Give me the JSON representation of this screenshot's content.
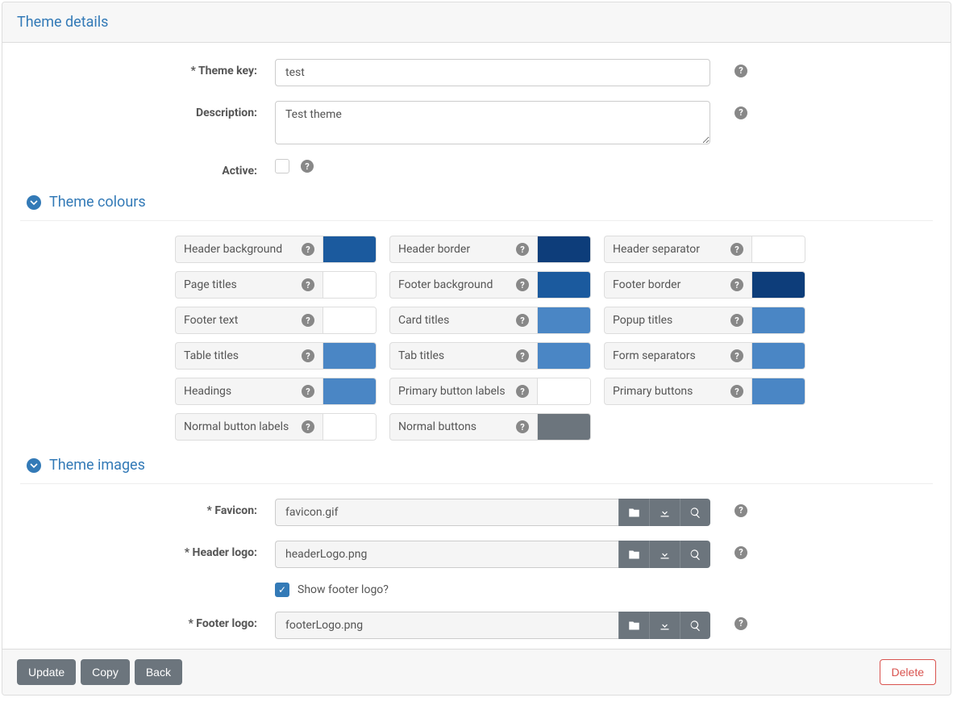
{
  "header": {
    "title": "Theme details"
  },
  "details": {
    "theme_key_label": "* Theme key:",
    "theme_key": "test",
    "description_label": "Description:",
    "description": "Test theme",
    "active_label": "Active:",
    "active": false
  },
  "sections": {
    "colours": {
      "title": "Theme colours"
    },
    "images": {
      "title": "Theme images"
    }
  },
  "colours": [
    {
      "label": "Header background",
      "value": "#1b5a9e"
    },
    {
      "label": "Header border",
      "value": "#0d3d7a"
    },
    {
      "label": "Header separator",
      "value": "#ffffff"
    },
    {
      "label": "Page titles",
      "value": "#ffffff"
    },
    {
      "label": "Footer background",
      "value": "#1b5a9e"
    },
    {
      "label": "Footer border",
      "value": "#0d3d7a"
    },
    {
      "label": "Footer text",
      "value": "#ffffff"
    },
    {
      "label": "Card titles",
      "value": "#4a86c5"
    },
    {
      "label": "Popup titles",
      "value": "#4a86c5"
    },
    {
      "label": "Table titles",
      "value": "#4a86c5"
    },
    {
      "label": "Tab titles",
      "value": "#4a86c5"
    },
    {
      "label": "Form separators",
      "value": "#4a86c5"
    },
    {
      "label": "Headings",
      "value": "#4a86c5"
    },
    {
      "label": "Primary button labels",
      "value": "#ffffff"
    },
    {
      "label": "Primary buttons",
      "value": "#4a86c5"
    },
    {
      "label": "Normal button labels",
      "value": "#ffffff"
    },
    {
      "label": "Normal buttons",
      "value": "#6c757d"
    }
  ],
  "images": {
    "favicon_label": "* Favicon:",
    "favicon": "favicon.gif",
    "header_logo_label": "* Header logo:",
    "header_logo": "headerLogo.png",
    "show_footer_label": "Show footer logo?",
    "show_footer": true,
    "footer_logo_label": "* Footer logo:",
    "footer_logo": "footerLogo.png"
  },
  "buttons": {
    "update": "Update",
    "copy": "Copy",
    "back": "Back",
    "delete": "Delete"
  }
}
